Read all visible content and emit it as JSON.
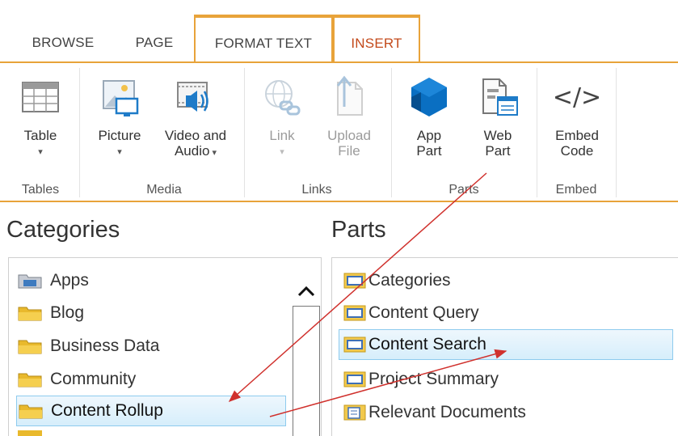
{
  "tabs": [
    {
      "label": "BROWSE"
    },
    {
      "label": "PAGE"
    },
    {
      "label": "FORMAT TEXT"
    },
    {
      "label": "INSERT"
    }
  ],
  "ribbon": {
    "buttons": {
      "table": "Table",
      "picture": "Picture",
      "video_l1": "Video and",
      "video_l2": "Audio",
      "link": "Link",
      "upload_l1": "Upload",
      "upload_l2": "File",
      "app_l1": "App",
      "app_l2": "Part",
      "web_l1": "Web",
      "web_l2": "Part",
      "embed_l1": "Embed",
      "embed_l2": "Code",
      "embed_glyph": "</>"
    },
    "groups": {
      "tables": "Tables",
      "media": "Media",
      "links": "Links",
      "parts": "Parts",
      "embed": "Embed"
    }
  },
  "categories": {
    "heading": "Categories",
    "items": [
      "Apps",
      "Blog",
      "Business Data",
      "Community",
      "Content Rollup"
    ],
    "selected": "Content Rollup"
  },
  "parts": {
    "heading": "Parts",
    "items": [
      "Categories",
      "Content Query",
      "Content Search",
      "Project Summary",
      "Relevant Documents"
    ],
    "selected": "Content Search"
  },
  "colors": {
    "accent_orange": "#e8a33a",
    "active_tab_text": "#c34a1b",
    "selection_border": "#8ecbee",
    "arrow_red": "#d0312d",
    "app_part_blue": "#0a6fc2"
  }
}
